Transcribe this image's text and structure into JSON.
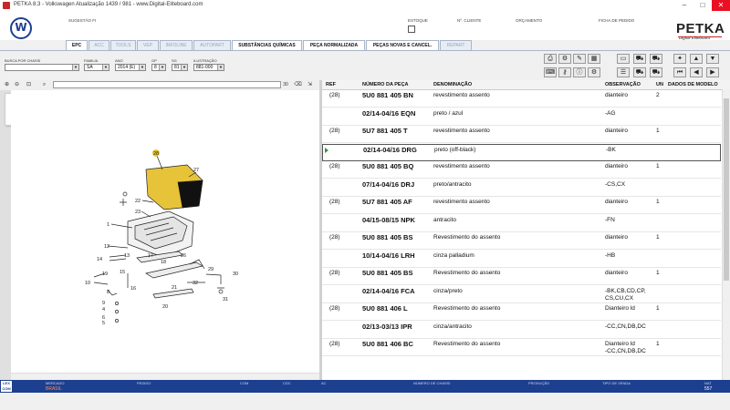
{
  "window": {
    "title": "PETKA 8.3 - Volkswagen Atualização 1439 / 981 - www.Digital-Eliteboard.com"
  },
  "header": {
    "labels": {
      "sugestao": "SUGESTÃO FI",
      "estoque": "ESTOQUE",
      "cliente": "Nº. CLIENTE",
      "orcamento": "ORÇAMENTO",
      "ficha": "FICHA DE PEDIDO"
    },
    "logo_big": "PETKA",
    "logo_small": "Digital Eliteboard"
  },
  "tabs": [
    "EPC",
    "ACC",
    "TOOLS",
    "VEP",
    "INFOLINE",
    "AUTOPART",
    "SUBSTÂNCIAS QUÍMICAS",
    "PEÇA NORMALIZADA",
    "PEÇAS NOVAS E CANCEL.",
    "REPART"
  ],
  "filters": {
    "busca_label": "BUSCA POR CHASSI",
    "familia_label": "FAMILIA",
    "familia": "SA",
    "ano_label": "ANO",
    "ano": "2014 (E)",
    "gp_label": "GP",
    "gp": "8",
    "sg_label": "SG",
    "sg": "81",
    "ilustracao_label": "ILUSTRAÇÃO",
    "ilustracao": "881-000"
  },
  "search": {
    "count": "30"
  },
  "grid": {
    "headers": {
      "ref": "REF",
      "num": "NÚMERO DA PEÇA",
      "den": "DENOMINAÇÃO",
      "obs": "OBSERVAÇÃO",
      "un": "UN",
      "dados": "DADOS DE MODELO"
    },
    "rows": [
      {
        "ref": "(28)",
        "num": "5U0 881 405 BN",
        "den": "revestimento assento",
        "obs": "dianteiro",
        "un": "2"
      },
      {
        "ref": "",
        "num": "02/14-04/16 EQN",
        "den": "preto / azul",
        "obs": "-AG",
        "un": ""
      },
      {
        "ref": "(28)",
        "num": "5U7 881 405 T",
        "den": "revestimento assento",
        "obs": "dianteiro",
        "un": "1"
      },
      {
        "ref": "",
        "num": "02/14-04/16 DRG",
        "den": "preto (off-black)",
        "obs": "-BK",
        "un": ""
      },
      {
        "ref": "(28)",
        "num": "5U0 881 405 BQ",
        "den": "revestimento assento",
        "obs": "dianteiro",
        "un": "1"
      },
      {
        "ref": "",
        "num": "07/14-04/16 DRJ",
        "den": "preto/antracito",
        "obs": "-CS,CX",
        "un": ""
      },
      {
        "ref": "(28)",
        "num": "5U7 881 405 AF",
        "den": "revestimento assento",
        "obs": "dianteiro",
        "un": "1"
      },
      {
        "ref": "",
        "num": "04/15-08/15 NPK",
        "den": "antracito",
        "obs": "-FN",
        "un": ""
      },
      {
        "ref": "(28)",
        "num": "5U0 881 405 BS",
        "den": "Revestimento do assento",
        "obs": "dianteiro",
        "un": "1"
      },
      {
        "ref": "",
        "num": "10/14-04/16 LRH",
        "den": "cinza palladium",
        "obs": "-HB",
        "un": ""
      },
      {
        "ref": "(28)",
        "num": "5U0 881 405 BS",
        "den": "Revestimento do assento",
        "obs": "dianteiro",
        "un": "1"
      },
      {
        "ref": "",
        "num": "02/14-04/16 FCA",
        "den": "cinza/preto",
        "obs": "-BK,CB,CD,CP,",
        "obs2": "CS,CU,CX",
        "un": ""
      },
      {
        "ref": "(28)",
        "num": "5U0 881 406 L",
        "den": "Revestimento do assento",
        "obs": "Dianteiro ld",
        "un": "1"
      },
      {
        "ref": "",
        "num": "02/13-03/13 IPR",
        "den": "cinza/antracito",
        "obs": "-CC,CN,DB,DC",
        "un": ""
      },
      {
        "ref": "(28)",
        "num": "5U0 881 406 BC",
        "den": "Revestimento do assento",
        "obs": "Dianteiro ld",
        "obs2": "-CC,CN,DB,DC",
        "un": "1"
      }
    ]
  },
  "diagram": {
    "labels": [
      "28",
      "27",
      "22",
      "23",
      "1",
      "12",
      "13",
      "14",
      "19",
      "10",
      "15",
      "8",
      "16",
      "17",
      "26",
      "18",
      "29",
      "30",
      "32",
      "31",
      "21",
      "20",
      "9",
      "4",
      "6",
      "5"
    ]
  },
  "statusbar": {
    "badge": "LEX COM",
    "mercado_label": "MERCADO",
    "mercado": "BRASIL",
    "pedido_label": "PEDIDO",
    "com_label": "COM",
    "cdc_label": "CDC",
    "ac_label": "AC",
    "chassi_label": "NÚMERO DE CHASSI",
    "producao_label": "PRODUÇÃO",
    "venda_label": "TIPO DE VENDA",
    "nat_label": "NAT",
    "nat": "557"
  }
}
